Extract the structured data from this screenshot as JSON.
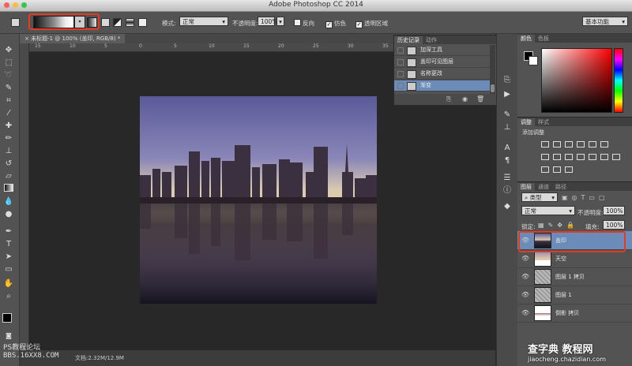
{
  "app": {
    "title": "Adobe Photoshop CC 2014"
  },
  "options": {
    "mode_label": "模式:",
    "mode_value": "正常",
    "opacity_label": "不透明度:",
    "opacity_value": "100%",
    "reverse_label": "反向",
    "dither_label": "仿色",
    "transparency_label": "透明区域",
    "workspace": "基本功能"
  },
  "document": {
    "tab_title": "未标题-1 @ 100% (盖印, RGB/8) *",
    "ruler_ticks": [
      "15",
      "10",
      "5",
      "0",
      "5",
      "10",
      "15",
      "20",
      "25",
      "30",
      "35",
      "40",
      "45",
      "50"
    ]
  },
  "history": {
    "tabs": [
      "历史记录",
      "动作"
    ],
    "items": [
      {
        "label": "加深工具",
        "selected": false
      },
      {
        "label": "盖印可见图层",
        "selected": false
      },
      {
        "label": "名称更改",
        "selected": false
      },
      {
        "label": "渐变",
        "selected": true
      }
    ]
  },
  "color_panel": {
    "tabs": [
      "颜色",
      "色板"
    ]
  },
  "adjustments": {
    "tabs": [
      "调整",
      "样式"
    ],
    "add_label": "添加调整"
  },
  "layers_panel": {
    "tabs": [
      "图层",
      "通道",
      "路径"
    ],
    "filter_kind": "类型",
    "blend_mode": "正常",
    "opacity_label": "不透明度:",
    "opacity_value": "100%",
    "lock_label": "锁定:",
    "fill_label": "填充:",
    "fill_value": "100%",
    "layers": [
      {
        "name": "盖印",
        "selected": true
      },
      {
        "name": "天空",
        "selected": false
      },
      {
        "name": "图层 1 拷贝",
        "selected": false
      },
      {
        "name": "图层 1",
        "selected": false
      },
      {
        "name": "倒影 拷贝",
        "selected": false
      }
    ]
  },
  "status": {
    "doc_size": "文档:2.32M/12.9M",
    "watermark_left_1": "PS教程论坛",
    "watermark_left_2": "BBS.16XX8.COM",
    "watermark_right_1": "查字典 教程网",
    "watermark_right_2": "jiaocheng.chazidian.com"
  },
  "colors": {
    "ui_bg": "#535353",
    "canvas_bg": "#282828",
    "highlight": "#e53a1e",
    "selected_row": "#6b8cb8"
  }
}
